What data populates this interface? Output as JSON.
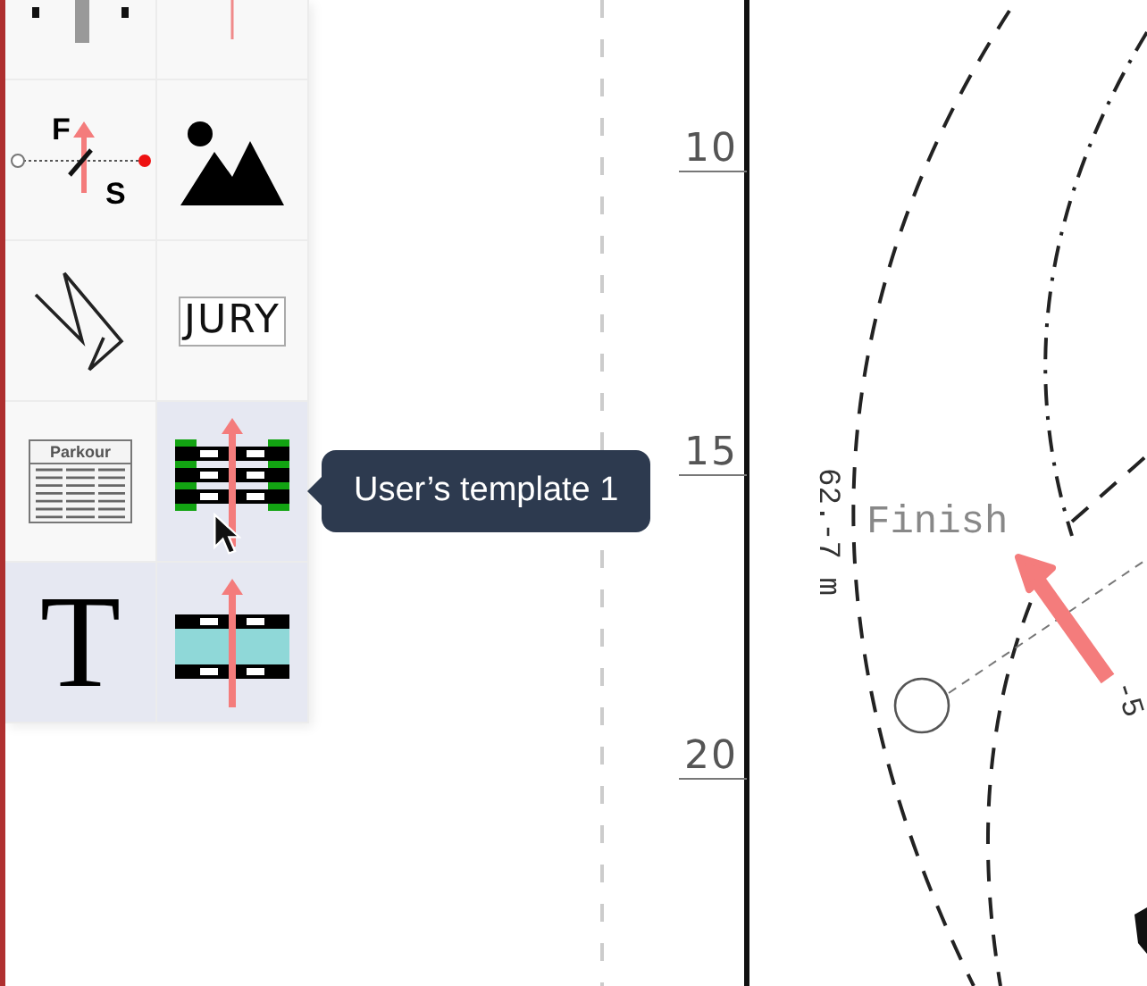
{
  "palette": {
    "tiles": [
      {
        "kind": "gate-partial",
        "highlighted": false
      },
      {
        "kind": "arrow-partial",
        "highlighted": false
      },
      {
        "kind": "start-finish",
        "highlighted": false,
        "labels": [
          "F",
          "S"
        ]
      },
      {
        "kind": "image",
        "highlighted": false
      },
      {
        "kind": "zigzag",
        "highlighted": false
      },
      {
        "kind": "jury",
        "highlighted": false,
        "label": "JURY"
      },
      {
        "kind": "parkour",
        "highlighted": false,
        "label": "Parkour"
      },
      {
        "kind": "template",
        "highlighted": true,
        "color": "#12a312"
      },
      {
        "kind": "text",
        "highlighted": true,
        "label": "T"
      },
      {
        "kind": "template",
        "highlighted": true,
        "color": "#8fd8d8"
      }
    ]
  },
  "tooltip": {
    "text": "User’s template 1"
  },
  "ruler": {
    "labels": [
      "10",
      "15",
      "20"
    ]
  },
  "course": {
    "finish_label": "Finish",
    "distances": [
      "62.-7 m",
      "-5"
    ]
  }
}
